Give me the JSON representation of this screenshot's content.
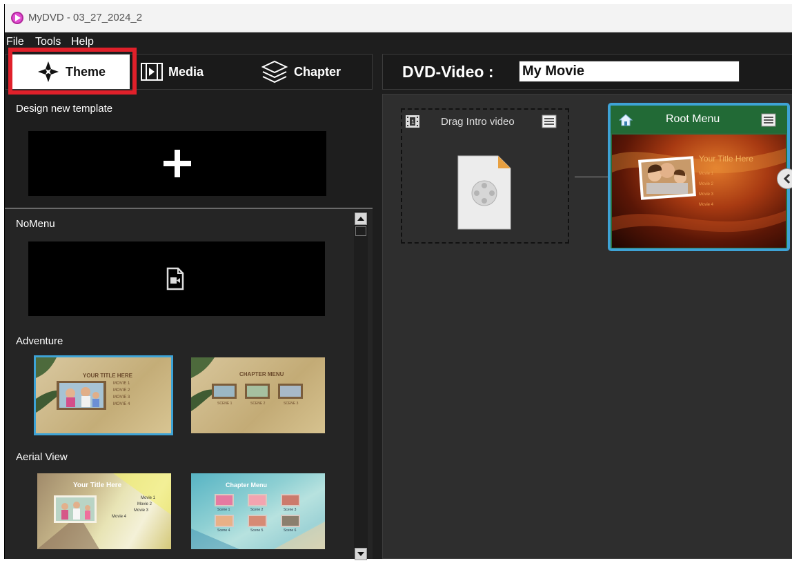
{
  "window": {
    "title": "MyDVD - 03_27_2024_2"
  },
  "menu": {
    "file": "File",
    "tools": "Tools",
    "help": "Help"
  },
  "tabs": {
    "theme": "Theme",
    "media": "Media",
    "chapter": "Chapter",
    "active": "Theme"
  },
  "left_panel": {
    "design_new_template": "Design new template",
    "categories": [
      {
        "name": "NoMenu"
      },
      {
        "name": "Adventure",
        "thumbnails": [
          {
            "title": "YOUR TITLE HERE",
            "items": [
              "MOVIE 1",
              "MOVIE 2",
              "MOVIE 3",
              "MOVIE 4"
            ]
          },
          {
            "title": "CHAPTER MENU",
            "items": [
              "SCENE 1",
              "SCENE 2",
              "SCENE 3"
            ]
          }
        ]
      },
      {
        "name": "Aerial View",
        "thumbnails": [
          {
            "title": "Your Title Here",
            "items": [
              "Movie 1",
              "Movie 2",
              "Movie 3",
              "Movie 4"
            ]
          },
          {
            "title": "Chapter Menu",
            "items": [
              "Scene 1",
              "Scene 2",
              "Scene 3",
              "Scene 4",
              "Scene 5",
              "Scene 6"
            ]
          }
        ]
      }
    ]
  },
  "dvd": {
    "label": "DVD-Video :",
    "title_value": "My Movie",
    "intro": {
      "label": "Drag Intro video"
    },
    "root_menu": {
      "label": "Root Menu",
      "preview_title": "Your Title Here",
      "preview_items": [
        "Movie 1",
        "Movie 2",
        "Movie 3",
        "Movie 4"
      ]
    }
  },
  "colors": {
    "accent": "#3ea3d6",
    "highlight": "#e0202a",
    "root_header": "#226a36"
  },
  "icons": [
    "app-logo-icon",
    "theme-icon",
    "media-icon",
    "chapter-icon",
    "plus-icon",
    "video-file-icon",
    "intro-film-icon",
    "list-icon",
    "home-icon",
    "chevron-left-icon",
    "scroll-up-icon",
    "scroll-down-icon"
  ]
}
